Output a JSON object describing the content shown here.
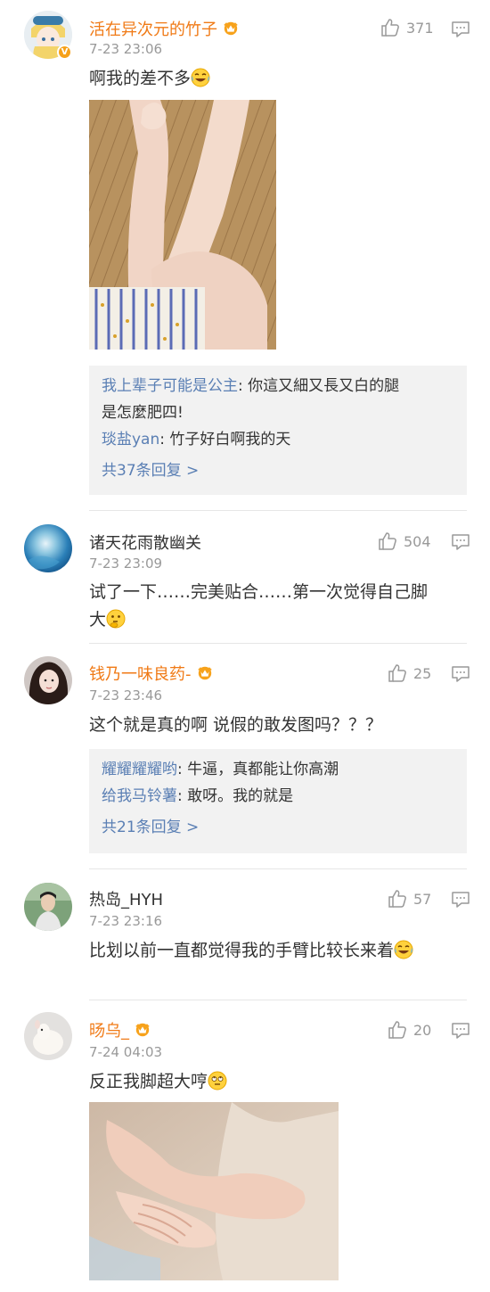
{
  "comments": [
    {
      "username": "活在异次元的竹子",
      "time": "7-23 23:06",
      "likes": "371",
      "text": "啊我的差不多",
      "emoji": "laugh-cry",
      "replies": [
        {
          "name": "我上辈子可能是公主",
          "text": ": 你這又細又長又白的腿",
          "cont": "是怎麼肥四!"
        },
        {
          "name": "琰盐yan",
          "text": ": 竹子好白啊我的天"
        }
      ],
      "more": "共37条回复 >"
    },
    {
      "username": "诸天花雨散幽关",
      "time": "7-23 23:09",
      "likes": "504",
      "text_line1": "试了一下……完美贴合……第一次觉得自己脚",
      "text_line2": "大",
      "emoji": "thinking"
    },
    {
      "username": "钱乃一味良药-",
      "time": "7-23 23:46",
      "likes": "25",
      "text": "这个就是真的啊 说假的敢发图吗？？？",
      "replies": [
        {
          "name": "耀耀耀耀哟",
          "text": ": 牛逼，真都能让你高潮"
        },
        {
          "name": "给我马铃薯",
          "text": ": 敢呀。我的就是"
        }
      ],
      "more": "共21条回复 >"
    },
    {
      "username": "热岛_HYH",
      "time": "7-23 23:16",
      "likes": "57",
      "text": "比划以前一直都觉得我的手臂比较长来着",
      "emoji": "laugh-cry"
    },
    {
      "username": "旸乌_",
      "time": "7-24 04:03",
      "likes": "20",
      "text": "反正我脚超大哼",
      "emoji": "eye-roll"
    }
  ],
  "colors": {
    "vip_name": "#f07a16",
    "reply_name": "#5a7fb4",
    "meta_gray": "#999999",
    "reply_bg": "#f2f2f2"
  }
}
